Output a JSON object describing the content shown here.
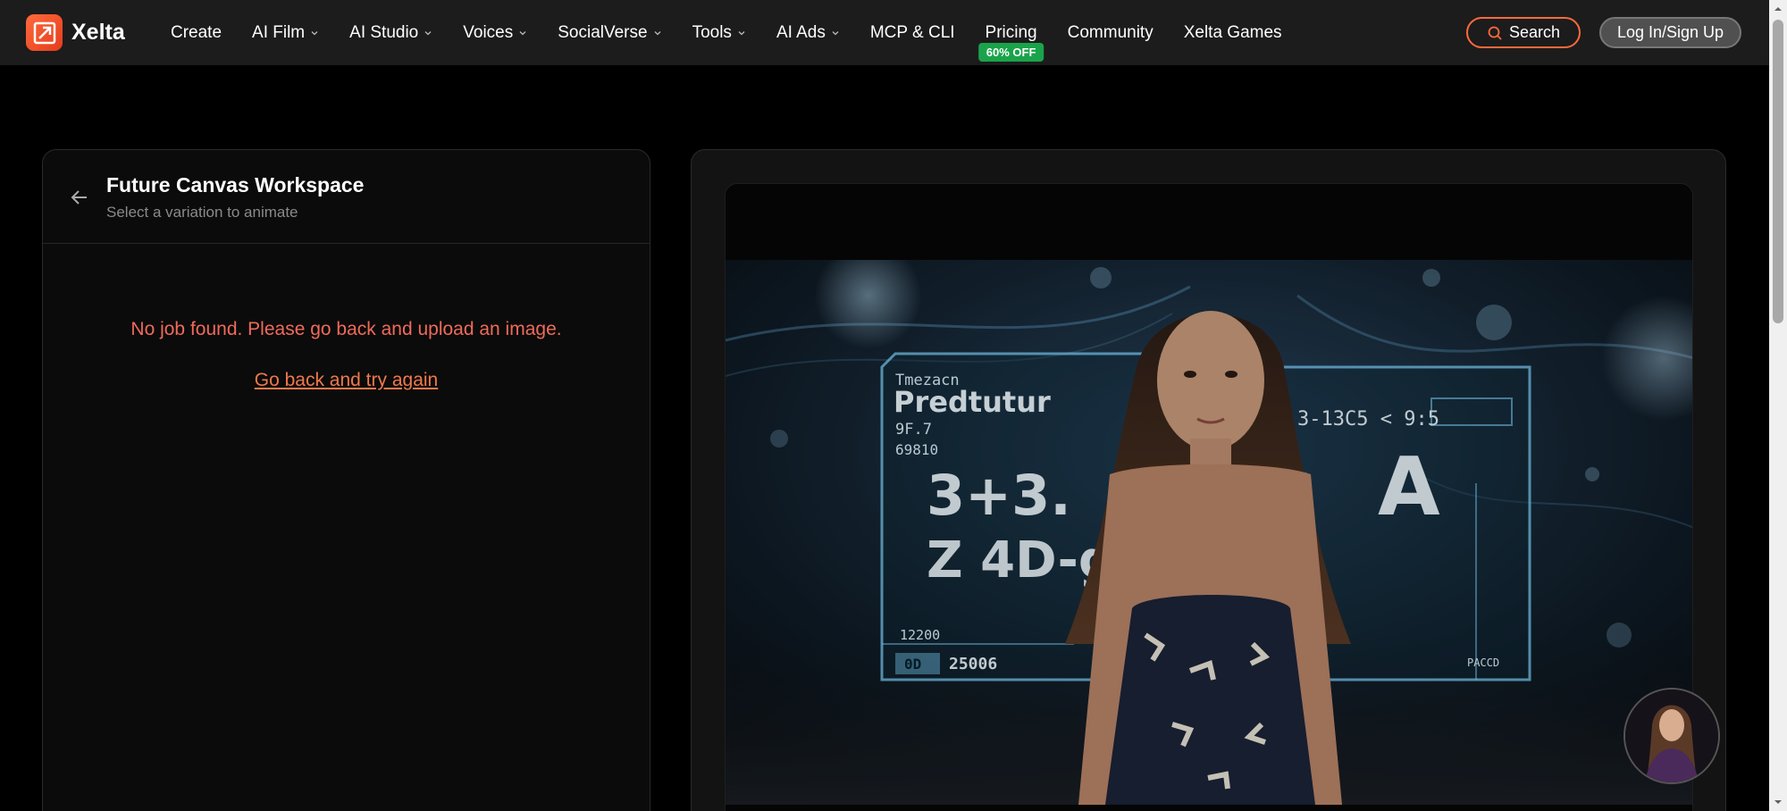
{
  "brand": {
    "name": "Xelta"
  },
  "nav": {
    "items": [
      {
        "label": "Create",
        "dropdown": false
      },
      {
        "label": "AI Film",
        "dropdown": true
      },
      {
        "label": "AI Studio",
        "dropdown": true
      },
      {
        "label": "Voices",
        "dropdown": true
      },
      {
        "label": "SocialVerse",
        "dropdown": true
      },
      {
        "label": "Tools",
        "dropdown": true
      },
      {
        "label": "AI Ads",
        "dropdown": true
      },
      {
        "label": "MCP & CLI",
        "dropdown": false
      },
      {
        "label": "Pricing",
        "dropdown": false,
        "badge": "60% OFF"
      },
      {
        "label": "Community",
        "dropdown": false
      },
      {
        "label": "Xelta Games",
        "dropdown": false
      }
    ],
    "search_label": "Search",
    "login_label": "Log In/Sign Up"
  },
  "workspace": {
    "title": "Future Canvas Workspace",
    "subtitle": "Select a variation to animate",
    "error_message": "No job found. Please go back and upload an image.",
    "retry_label": "Go back and try again"
  },
  "preview": {
    "hud_title_small": "Tmezacn",
    "hud_title": "Predtutur",
    "hud_line1": "9F.7",
    "hud_line2": "69810",
    "hud_big1": "3+3.",
    "hud_big2": "Z 4D-g-",
    "hud_code": "3-13C5 < 9:5",
    "hud_letter": "A",
    "hud_bottom1": "12200",
    "hud_bottom_tag": "0D",
    "hud_bottom2": "25006",
    "hud_corner": "PACCD"
  },
  "colors": {
    "accent": "#ff6a3d",
    "error": "#f06a5a",
    "badge": "#1aa34a",
    "hud": "#7fd4ff"
  }
}
